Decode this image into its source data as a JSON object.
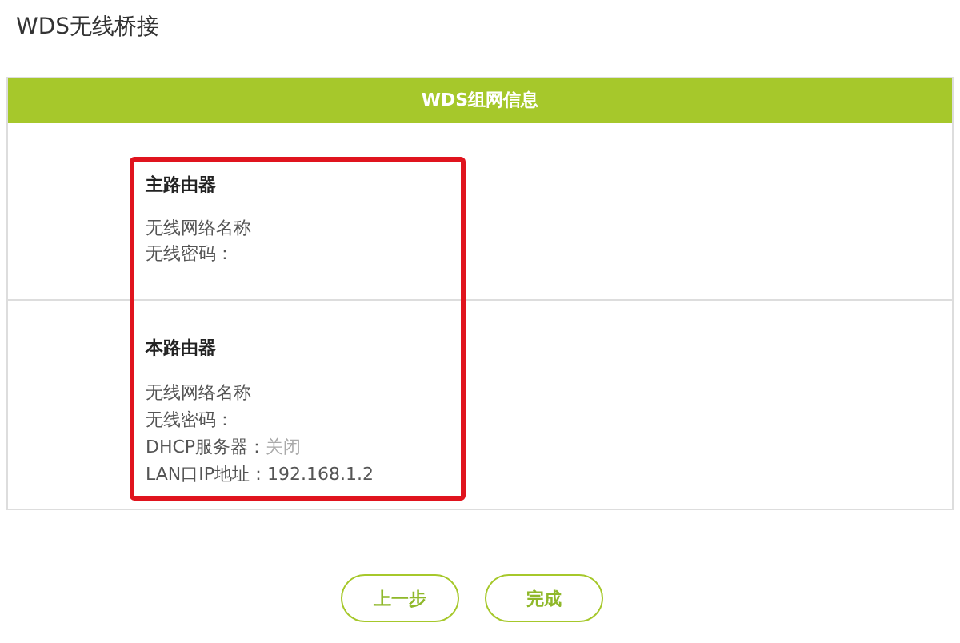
{
  "page_title": "WDS无线桥接",
  "panel": {
    "header": "WDS组网信息",
    "sections": [
      {
        "heading": "主路由器",
        "rows": [
          {
            "label": "无线网络名称"
          },
          {
            "label": "无线密码："
          }
        ]
      },
      {
        "heading": "本路由器",
        "rows": [
          {
            "label": "无线网络名称"
          },
          {
            "label": "无线密码："
          },
          {
            "label": "DHCP服务器：",
            "value": "关闭",
            "muted": true
          },
          {
            "label": "LAN口IP地址：",
            "value": "192.168.1.2",
            "muted": false
          }
        ]
      }
    ]
  },
  "buttons": [
    {
      "label": "上一步"
    },
    {
      "label": "完成"
    }
  ]
}
